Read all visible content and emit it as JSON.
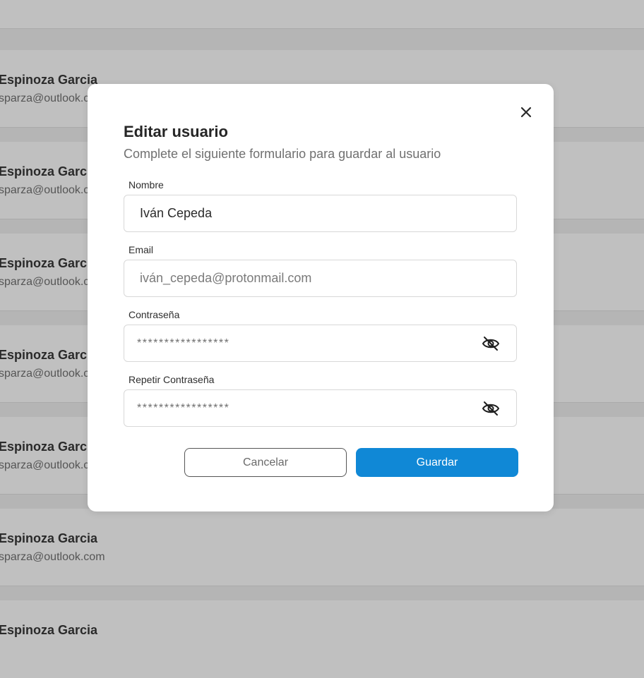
{
  "background_list": [
    {
      "name": "Espinoza Garcia",
      "email": "sparza@outlook.com"
    },
    {
      "name": "Espinoza Garcia",
      "email": "sparza@outlook.com"
    },
    {
      "name": "Espinoza Garcia",
      "email": "sparza@outlook.com"
    },
    {
      "name": "Espinoza Garcia",
      "email": "sparza@outlook.com"
    },
    {
      "name": "Espinoza Garcia",
      "email": "sparza@outlook.com"
    },
    {
      "name": "Espinoza Garcia",
      "email": "sparza@outlook.com"
    },
    {
      "name": "Espinoza Garcia",
      "email": ""
    }
  ],
  "modal": {
    "title": "Editar usuario",
    "subtitle": "Complete el siguiente formulario para guardar al usuario",
    "close_icon": "close-icon",
    "fields": {
      "name": {
        "label": "Nombre",
        "value": "Iván Cepeda"
      },
      "email": {
        "label": "Email",
        "value": "iván_cepeda@protonmail.com"
      },
      "password": {
        "label": "Contraseña",
        "value": "*****************",
        "icon": "eye-off-icon"
      },
      "repeat_password": {
        "label": "Repetir Contraseña",
        "value": "*****************",
        "icon": "eye-off-icon"
      }
    },
    "buttons": {
      "cancel": "Cancelar",
      "save": "Guardar"
    }
  },
  "colors": {
    "primary": "#1088d6",
    "overlay": "#c0c0c0",
    "surface": "#ffffff"
  }
}
